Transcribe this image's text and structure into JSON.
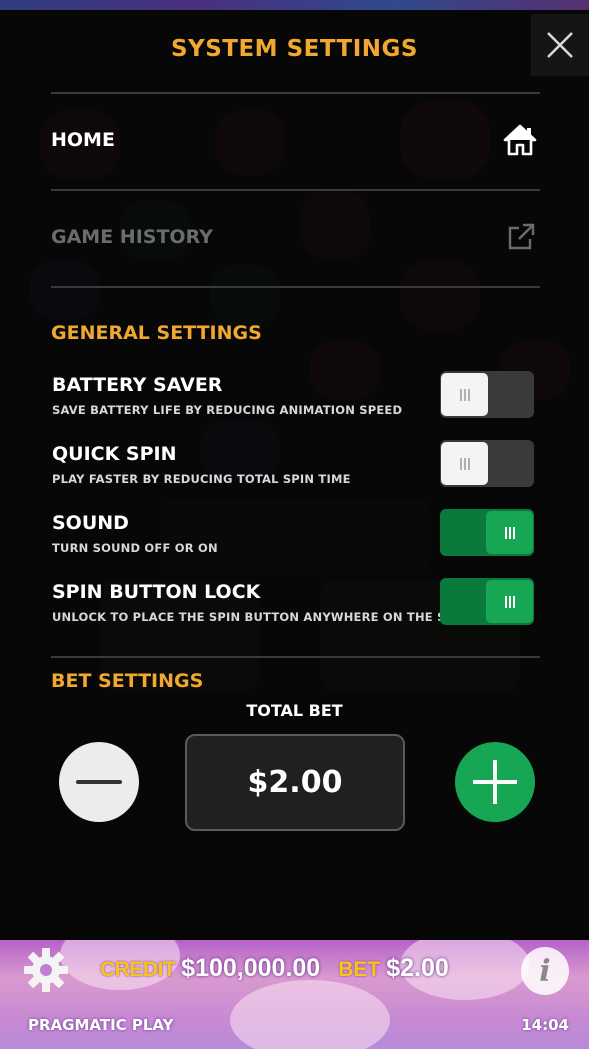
{
  "header": {
    "title": "SYSTEM SETTINGS"
  },
  "menu": {
    "home_label": "HOME",
    "history_label": "GAME HISTORY"
  },
  "general": {
    "heading": "GENERAL SETTINGS",
    "settings": [
      {
        "name": "BATTERY SAVER",
        "desc": "SAVE BATTERY LIFE BY REDUCING ANIMATION SPEED",
        "state": "off"
      },
      {
        "name": "QUICK SPIN",
        "desc": "PLAY FASTER BY REDUCING TOTAL SPIN TIME",
        "state": "off"
      },
      {
        "name": "SOUND",
        "desc": "TURN SOUND OFF OR ON",
        "state": "on"
      },
      {
        "name": "SPIN BUTTON LOCK",
        "desc": "UNLOCK TO PLACE THE SPIN BUTTON ANYWHERE ON THE SCREEN",
        "state": "on"
      }
    ]
  },
  "bet": {
    "heading": "BET SETTINGS",
    "total_label": "TOTAL BET",
    "value": "$2.00"
  },
  "footer": {
    "credit_label": "CREDIT",
    "credit_value": "$100,000.00",
    "bet_label": "BET",
    "bet_value": "$2.00",
    "brand": "PRAGMATIC PLAY",
    "time": "14:04"
  },
  "colors": {
    "accent": "#f0a830",
    "toggle_on": "#17a653",
    "plus_button": "#17a653"
  },
  "icons": {
    "close": "close-icon",
    "home": "home-icon",
    "history": "external-link-icon",
    "settings": "gear-icon",
    "info": "info-icon"
  }
}
